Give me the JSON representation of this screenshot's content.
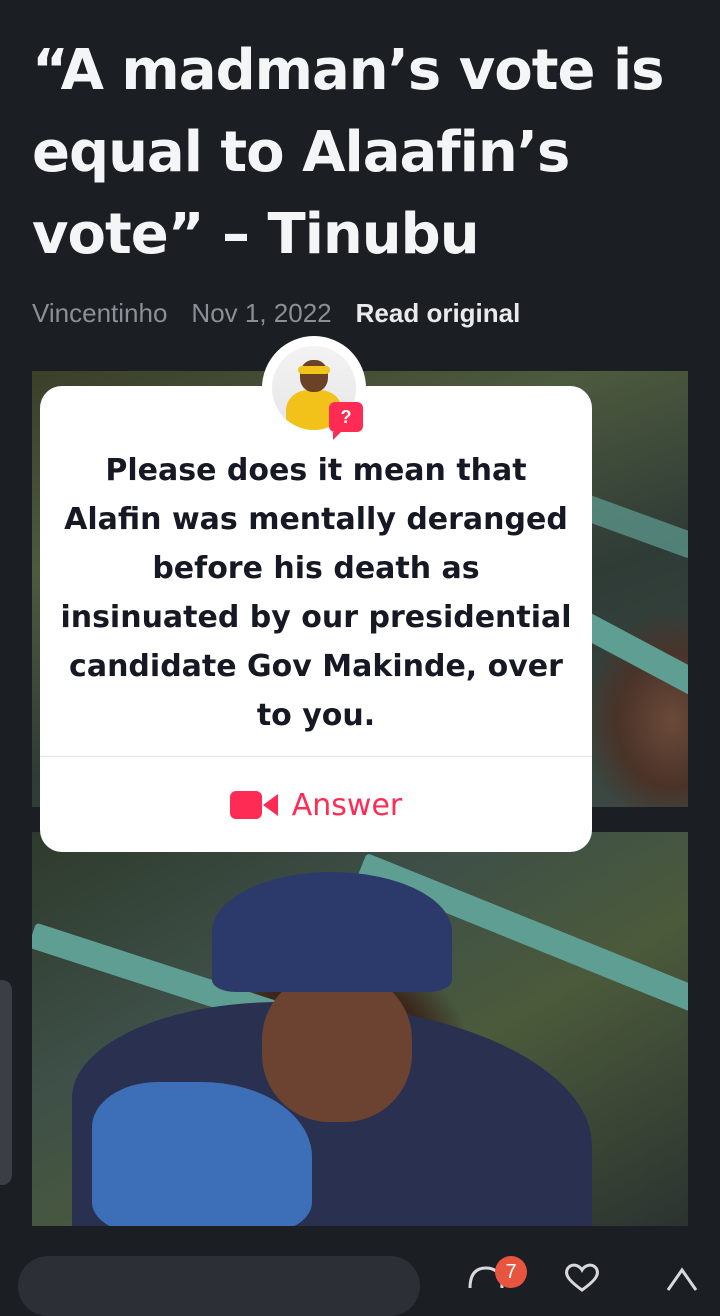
{
  "article": {
    "headline": "“A madman’s vote is equal to Alaafin’s vote” – Tinubu",
    "author": "Vincentinho",
    "date": "Nov 1, 2022",
    "read_original": "Read original"
  },
  "qa_card": {
    "badge": "?",
    "question": "Please does it mean that Alafin was mentally deranged before his death as insinuated by our presidential candidate Gov Makinde, over to you.",
    "answer_label": "Answer",
    "accent_color": "#fe2c55"
  },
  "bottom_bar": {
    "notification_count": "7",
    "icons": [
      "comment-icon",
      "heart-icon",
      "share-icon"
    ]
  }
}
